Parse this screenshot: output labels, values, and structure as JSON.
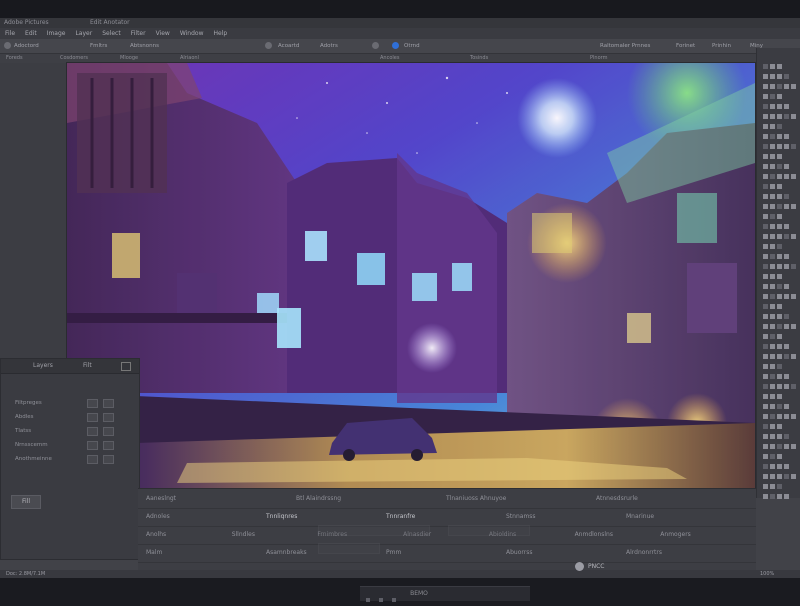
{
  "window": {
    "title": "Adobe Pictures",
    "tabs": "Edit Anotator"
  },
  "menubar": {
    "items": [
      "File",
      "Edit",
      "Image",
      "Layer",
      "Select",
      "Filter",
      "View",
      "Window",
      "Help"
    ]
  },
  "toolbar": {
    "label_a": "Adoctord",
    "label_b": "Fmltrs",
    "label_c": "Abtsnonns",
    "label_d": "Acoartd",
    "label_e": "Adotrs",
    "label_f": "Otrnd",
    "label_g": "Raltomaler Prnnes",
    "label_h": "Forinet",
    "label_i": "Prinhin",
    "label_j": "Miny"
  },
  "toolbar2": {
    "items": [
      "Foreds",
      "Cosdomers",
      "Mlooge",
      "Alriaonl",
      "Ancoles",
      "Tosinds",
      "Plnorm"
    ]
  },
  "layers_panel": {
    "header_left": "Layers",
    "header_right": "Filt",
    "rows": [
      "Filtpreges",
      "Abdles",
      "Tlatss",
      "Nrnsscemm",
      "Anothmeinne"
    ],
    "button": "Fill"
  },
  "bottom_panel": {
    "row1": [
      "Aaneslngt",
      "Btl Alaindrssng",
      "Tlnaniuoss Ahnuyoe",
      "Atnnesdsrurle"
    ],
    "row2": [
      "Adnoles",
      "Tnnliqnres",
      "Tnnranfre",
      "Stnnamss",
      "Mnarinue"
    ],
    "row3": [
      "Anolhs",
      "Sllndles",
      "Frnimbres",
      "Alnasdier",
      "Abioldins",
      "Anmdlonslns",
      "Anmogers"
    ],
    "row4": [
      "Malm",
      "Asamnbreaks",
      "Pmm",
      "Abuorrss",
      "Alrdnonrrtrs"
    ]
  },
  "status_bar": {
    "left": "Doc: 2.8M/7.1M",
    "right": "100%"
  },
  "logo_badge": {
    "text": "PNCC"
  },
  "stand": {
    "label": "BEMO"
  }
}
